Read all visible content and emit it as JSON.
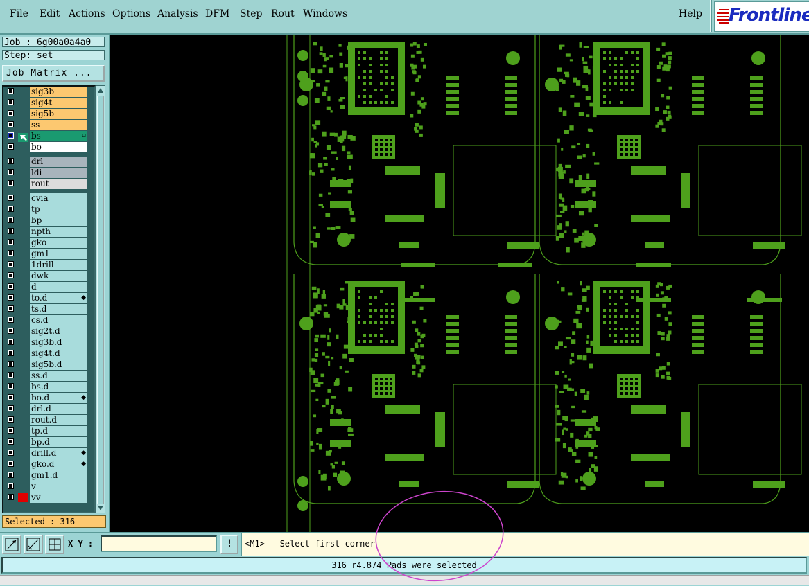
{
  "menubar": {
    "items": [
      {
        "label": "File",
        "key": "F"
      },
      {
        "label": "Edit",
        "key": "E"
      },
      {
        "label": "Actions",
        "key": "A"
      },
      {
        "label": "Options",
        "key": "O"
      },
      {
        "label": "Analysis",
        "key": ""
      },
      {
        "label": "DFM",
        "key": ""
      },
      {
        "label": "Step",
        "key": "S"
      },
      {
        "label": "Rout",
        "key": "R"
      },
      {
        "label": "Windows",
        "key": "W"
      }
    ],
    "help_label": "Help"
  },
  "logo": {
    "text": "Frontline",
    "icon": "frontline-logo-lines",
    "color": "#1a2bbf",
    "accent": "#cc0000"
  },
  "job_info": {
    "job": "Job : 6g00a0a4a0",
    "step": "Step: set"
  },
  "job_matrix_button": "Job Matrix ...",
  "layers": [
    {
      "name": "sig3b",
      "color": "#fcc870",
      "marker": ""
    },
    {
      "name": "sig4t",
      "color": "#fcc870",
      "marker": ""
    },
    {
      "name": "sig5b",
      "color": "#fcc870",
      "marker": ""
    },
    {
      "name": "ss",
      "color": "#fcc870",
      "marker": ""
    },
    {
      "name": "bs",
      "color": "#1a9a70",
      "marker": "work-layer",
      "tag": "▫"
    },
    {
      "name": "bo",
      "color": "#ffffff",
      "marker": ""
    },
    {
      "name": "drl",
      "color": "#a8b4bc",
      "marker": ""
    },
    {
      "name": "ldi",
      "color": "#a8b4bc",
      "marker": ""
    },
    {
      "name": "rout",
      "color": "#dcdcdc",
      "marker": ""
    },
    {
      "name": "cvia",
      "color": "#a8dcdc",
      "marker": ""
    },
    {
      "name": "tp",
      "color": "#a8dcdc",
      "marker": ""
    },
    {
      "name": "bp",
      "color": "#a8dcdc",
      "marker": ""
    },
    {
      "name": "npth",
      "color": "#a8dcdc",
      "marker": ""
    },
    {
      "name": "gko",
      "color": "#a8dcdc",
      "marker": ""
    },
    {
      "name": "gm1",
      "color": "#a8dcdc",
      "marker": ""
    },
    {
      "name": "1drill",
      "color": "#a8dcdc",
      "marker": ""
    },
    {
      "name": "dwk",
      "color": "#a8dcdc",
      "marker": ""
    },
    {
      "name": "d",
      "color": "#a8dcdc",
      "marker": ""
    },
    {
      "name": "to.d",
      "color": "#a8dcdc",
      "marker": "",
      "tag": "◆"
    },
    {
      "name": "ts.d",
      "color": "#a8dcdc",
      "marker": ""
    },
    {
      "name": "cs.d",
      "color": "#a8dcdc",
      "marker": ""
    },
    {
      "name": "sig2t.d",
      "color": "#a8dcdc",
      "marker": ""
    },
    {
      "name": "sig3b.d",
      "color": "#a8dcdc",
      "marker": ""
    },
    {
      "name": "sig4t.d",
      "color": "#a8dcdc",
      "marker": ""
    },
    {
      "name": "sig5b.d",
      "color": "#a8dcdc",
      "marker": ""
    },
    {
      "name": "ss.d",
      "color": "#a8dcdc",
      "marker": ""
    },
    {
      "name": "bs.d",
      "color": "#a8dcdc",
      "marker": ""
    },
    {
      "name": "bo.d",
      "color": "#a8dcdc",
      "marker": "",
      "tag": "◆"
    },
    {
      "name": "drl.d",
      "color": "#a8dcdc",
      "marker": ""
    },
    {
      "name": "rout.d",
      "color": "#a8dcdc",
      "marker": ""
    },
    {
      "name": "tp.d",
      "color": "#a8dcdc",
      "marker": ""
    },
    {
      "name": "bp.d",
      "color": "#a8dcdc",
      "marker": ""
    },
    {
      "name": "drill.d",
      "color": "#a8dcdc",
      "marker": "",
      "tag": "◆"
    },
    {
      "name": "gko.d",
      "color": "#a8dcdc",
      "marker": "",
      "tag": "◆"
    },
    {
      "name": "gm1.d",
      "color": "#a8dcdc",
      "marker": ""
    },
    {
      "name": "v",
      "color": "#a8dcdc",
      "marker": ""
    },
    {
      "name": "vv",
      "color": "#a8dcdc",
      "marker": "red"
    }
  ],
  "selected_count": "Selected : 316",
  "toolbar": {
    "xy_label": "X Y :",
    "xy_value": "",
    "alert_label": "!",
    "prompt": "<M1> - Select first corner"
  },
  "status": "316 r4.874 Pads were selected",
  "canvas": {
    "background": "#000000",
    "feature_color": "#4ea01c"
  }
}
